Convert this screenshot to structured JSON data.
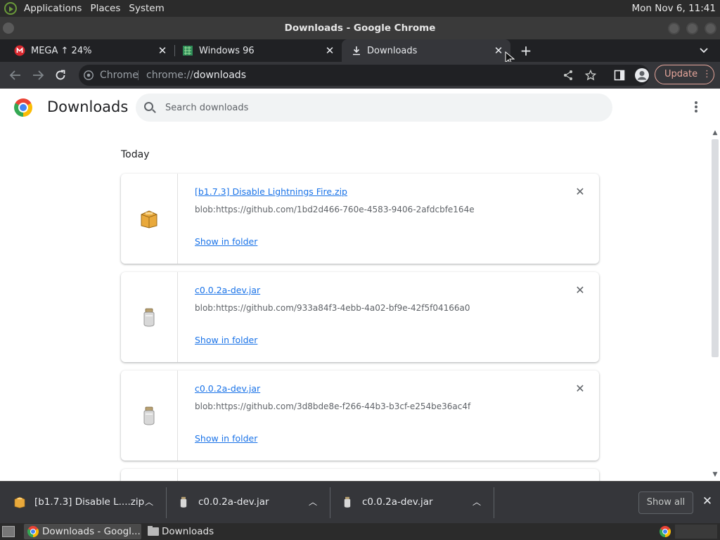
{
  "system_panel": {
    "menus": [
      "Applications",
      "Places",
      "System"
    ],
    "clock": "Mon Nov 6, 11:41"
  },
  "window": {
    "title": "Downloads - Google Chrome"
  },
  "tabs": [
    {
      "title": "MEGA ↑ 24%",
      "icon": "mega-icon",
      "active": false
    },
    {
      "title": "Windows 96",
      "icon": "windows96-icon",
      "active": false
    },
    {
      "title": "Downloads",
      "icon": "download-icon",
      "active": true
    }
  ],
  "toolbar": {
    "site_label": "Chrome",
    "url_scheme": "chrome://",
    "url_path": "downloads",
    "update_label": "Update"
  },
  "page": {
    "title": "Downloads",
    "search_placeholder": "Search downloads",
    "section_date": "Today",
    "downloads": [
      {
        "name": "[b1.7.3] Disable Lightnings Fire.zip",
        "url": "blob:https://github.com/1bd2d466-760e-4583-9406-2afdcbfe164e",
        "action": "Show in folder",
        "icon": "zip-archive-icon"
      },
      {
        "name": "c0.0.2a-dev.jar",
        "url": "blob:https://github.com/933a84f3-4ebb-4a02-bf9e-42f5f04166a0",
        "action": "Show in folder",
        "icon": "jar-icon"
      },
      {
        "name": "c0.0.2a-dev.jar",
        "url": "blob:https://github.com/3d8bde8e-f266-44b3-b3cf-e254be36ac4f",
        "action": "Show in folder",
        "icon": "jar-icon"
      }
    ]
  },
  "shelf": {
    "items": [
      {
        "name": "[b1.7.3] Disable L....zip",
        "icon": "zip-archive-icon"
      },
      {
        "name": "c0.0.2a-dev.jar",
        "icon": "jar-icon"
      },
      {
        "name": "c0.0.2a-dev.jar",
        "icon": "jar-icon"
      }
    ],
    "show_all_label": "Show all"
  },
  "taskbar": {
    "items": [
      {
        "label": "Downloads - Googl...",
        "icon": "chrome-icon",
        "active": true
      },
      {
        "label": "Downloads",
        "icon": "folder-icon",
        "active": false
      }
    ]
  },
  "colors": {
    "link_blue": "#1a73e8",
    "update_accent": "#e8a79c",
    "tab_strip": "#202124",
    "toolbar": "#35363a"
  }
}
